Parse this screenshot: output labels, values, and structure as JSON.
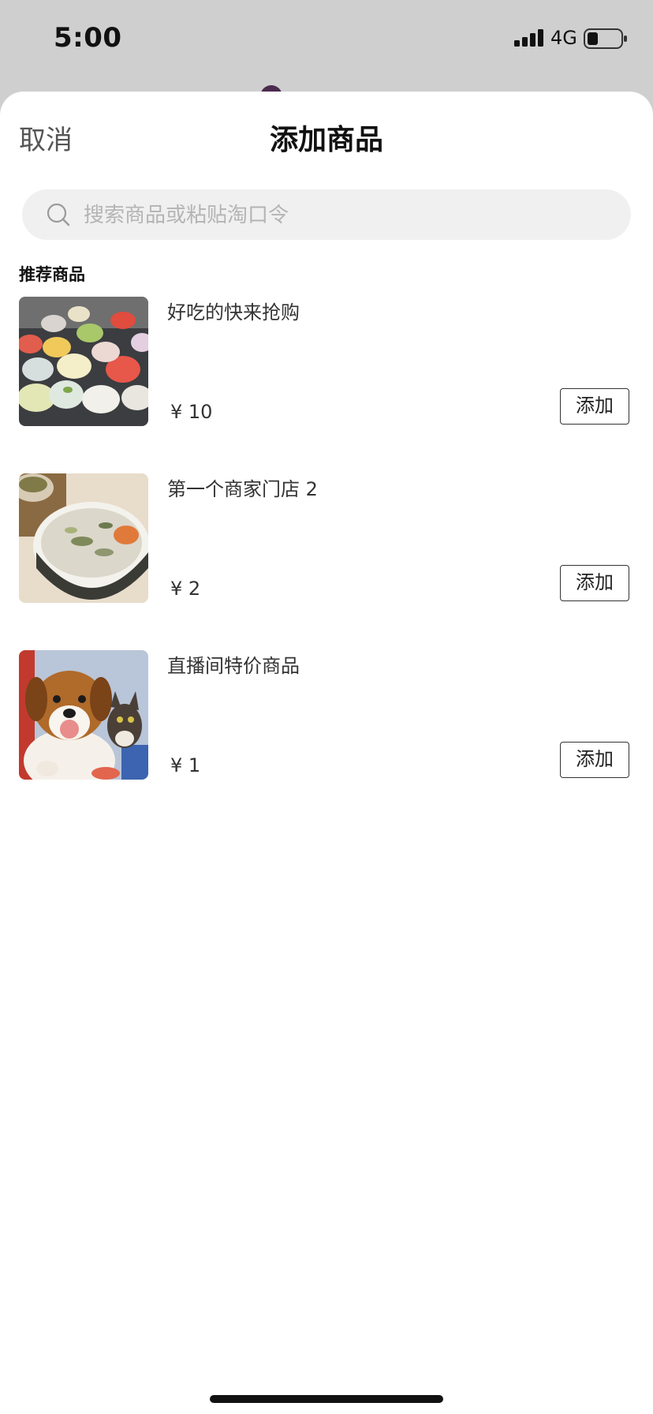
{
  "status_bar": {
    "time": "5:00",
    "network": "4G"
  },
  "header": {
    "cancel_label": "取消",
    "title": "添加商品"
  },
  "search": {
    "placeholder": "搜索商品或粘贴淘口令",
    "value": ""
  },
  "section": {
    "title": "推荐商品"
  },
  "products": [
    {
      "name": "好吃的快来抢购",
      "price": "¥ 10",
      "add_label": "添加",
      "image": "dumplings-photo"
    },
    {
      "name": "第一个商家门店 2",
      "price": "¥ 2",
      "add_label": "添加",
      "image": "congee-bowl-photo"
    },
    {
      "name": "直播间特价商品",
      "price": "¥ 1",
      "add_label": "添加",
      "image": "puppy-and-kitten-photo"
    }
  ]
}
